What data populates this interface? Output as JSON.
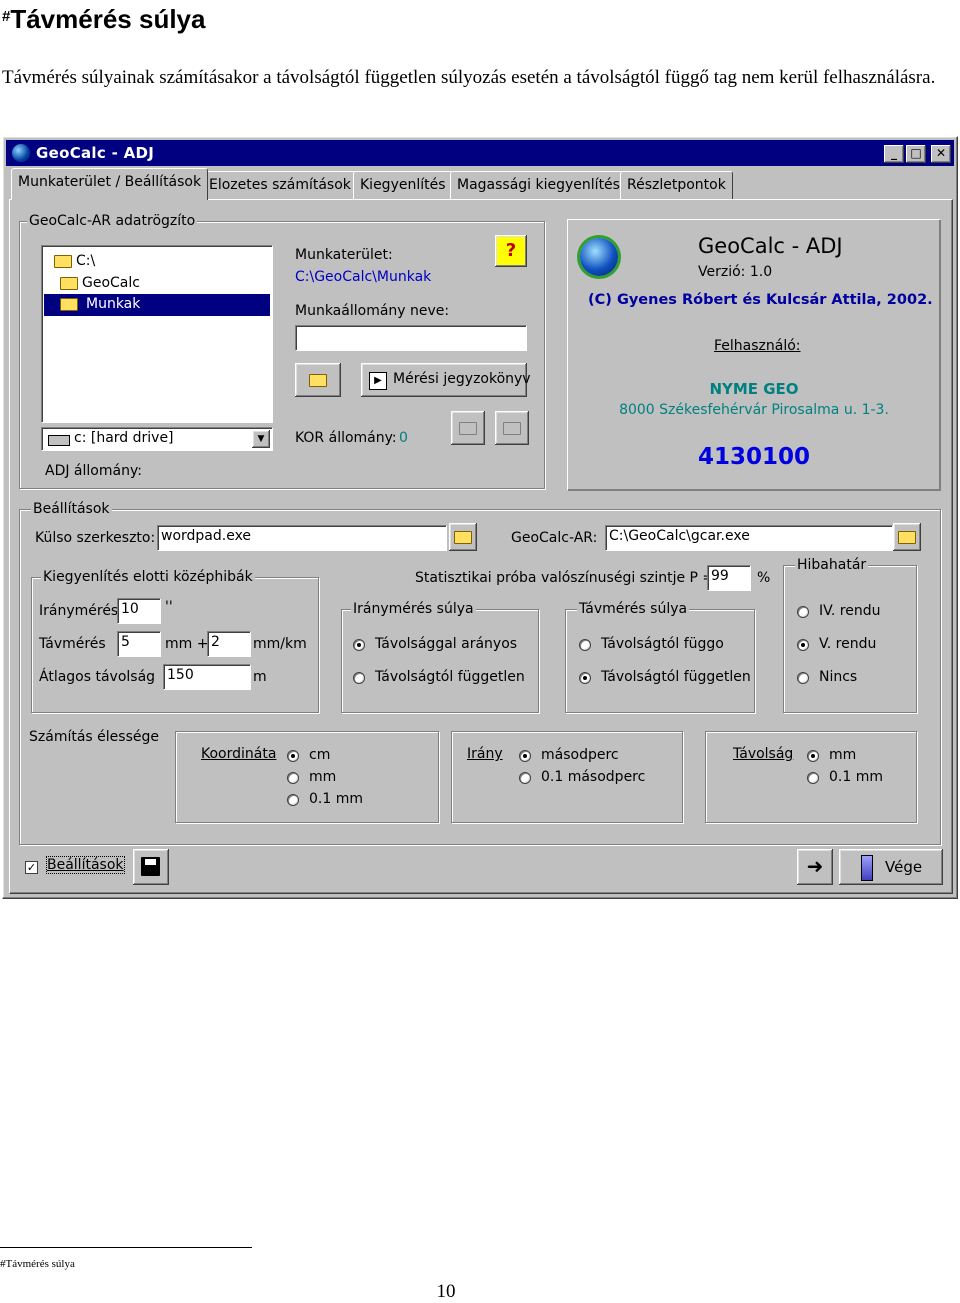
{
  "doc": {
    "heading_mark": "#",
    "heading": "Távmérés súlya",
    "paragraph": "Távmérés súlyainak számításakor a távolságtól független súlyozás esetén a távolságtól függő tag nem kerül felhasználásra.",
    "footnote": "#Távmérés súlya",
    "page_number": "10"
  },
  "window": {
    "title": "GeoCalc - ADJ",
    "controls": {
      "minimize": "_",
      "maximize": "□",
      "close": "✕"
    }
  },
  "tabs": [
    {
      "label": "Munkaterület / Beállítások",
      "active": true
    },
    {
      "label": "Elozetes számítások",
      "active": false
    },
    {
      "label": "Kiegyenlítés",
      "active": false
    },
    {
      "label": "Magassági kiegyenlítés",
      "active": false
    },
    {
      "label": "Részletpontok",
      "active": false
    }
  ],
  "recorder": {
    "legend": "GeoCalc-AR adatrögzíto",
    "folders": [
      "C:\\",
      "GeoCalc",
      "Munkak"
    ],
    "selected_folder": "Munkak",
    "drive": "c: [hard drive]",
    "adj_label": "ADJ állomány:",
    "workspace_label": "Munkaterület:",
    "workspace_path": "C:\\GeoCalc\\Munkak",
    "workfile_label": "Munkaállomány neve:",
    "workfile_value": "",
    "report_button": "Mérési jegyzokönyv",
    "kor_label": "KOR állomány:",
    "kor_value": "0",
    "help_glyph": "?"
  },
  "about": {
    "title": "GeoCalc - ADJ",
    "version": "Verzió: 1.0",
    "copyright": "(C) Gyenes Róbert és Kulcsár Attila, 2002.",
    "user_label": "Felhasználó:",
    "user_org": "NYME GEO",
    "user_address": "8000 Székesfehérvár Pirosalma u. 1-3.",
    "serial": "4130100"
  },
  "settings": {
    "legend": "Beállítások",
    "editor_label": "Külso szerkeszto:",
    "editor_value": "wordpad.exe",
    "gcar_label": "GeoCalc-AR:",
    "gcar_value": "C:\\GeoCalc\\gcar.exe",
    "prior_errors": {
      "legend": "Kiegyenlítés elotti középhibák",
      "direction_label": "Iránymérés",
      "direction_value": "10",
      "direction_unit": "''",
      "distance_label": "Távmérés",
      "distance_value": "5",
      "distance_unit1": "mm +",
      "distance_value2": "2",
      "distance_unit2": "mm/km",
      "avg_label": "Átlagos távolság",
      "avg_value": "150",
      "avg_unit": "m"
    },
    "stat_label": "Statisztikai próba valószínuségi szintje  P =",
    "stat_value": "99",
    "stat_unit": "%",
    "direction_weight": {
      "legend": "Iránymérés súlya",
      "options": [
        "Távolsággal arányos",
        "Távolságtól független"
      ],
      "selected": 0
    },
    "distance_weight": {
      "legend": "Távmérés súlya",
      "options": [
        "Távolságtól függo",
        "Távolságtól független"
      ],
      "selected": 1
    },
    "tolerance": {
      "legend": "Hibahatár",
      "options": [
        "IV. rendu",
        "V. rendu",
        "Nincs"
      ],
      "selected": 1
    },
    "precision": {
      "label": "Számítás élessége",
      "coord": {
        "label": "Koordináta",
        "options": [
          "cm",
          "mm",
          "0.1 mm"
        ],
        "selected": 0
      },
      "dir": {
        "label": "Irány",
        "options": [
          "másodperc",
          "0.1 másodperc"
        ],
        "selected": 0
      },
      "dist": {
        "label": "Távolság",
        "options": [
          "mm",
          "0.1 mm"
        ],
        "selected": 0
      }
    }
  },
  "footer": {
    "settings_checkbox_label": "Beállítások",
    "settings_checked": true,
    "exit_button": "Vége"
  }
}
